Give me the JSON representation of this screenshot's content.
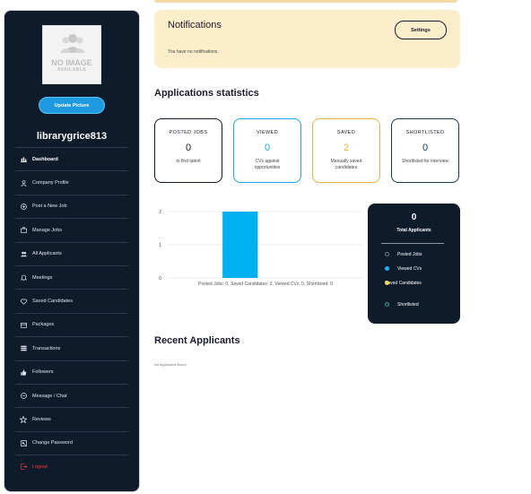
{
  "sidebar": {
    "avatar": {
      "no_image": "NO IMAGE",
      "available": "AVAILABLE"
    },
    "update_button": "Update Picture",
    "username": "librarygrice813",
    "items": [
      {
        "label": "Dashboard",
        "icon": "dashboard-icon"
      },
      {
        "label": "Company Profile",
        "icon": "user-icon"
      },
      {
        "label": "Post a New Job",
        "icon": "plus-circle-icon"
      },
      {
        "label": "Manage Jobs",
        "icon": "briefcase-icon"
      },
      {
        "label": "All Applicants",
        "icon": "users-icon"
      },
      {
        "label": "Meetings",
        "icon": "bell-icon"
      },
      {
        "label": "Saved Candidates",
        "icon": "heart-icon"
      },
      {
        "label": "Packages",
        "icon": "package-icon"
      },
      {
        "label": "Transactions",
        "icon": "transactions-icon"
      },
      {
        "label": "Followers",
        "icon": "thumbs-up-icon"
      },
      {
        "label": "Message / Chat",
        "icon": "chat-icon"
      },
      {
        "label": "Reviews",
        "icon": "star-icon"
      },
      {
        "label": "Change Password",
        "icon": "key-icon"
      },
      {
        "label": "Logout",
        "icon": "logout-icon"
      }
    ]
  },
  "notifications": {
    "title": "Notifications",
    "settings_button": "Settings",
    "empty": "You have no notifications."
  },
  "stats": {
    "title": "Applications statistics",
    "cards": [
      {
        "label": "POSTED JOBS",
        "value": "0",
        "sub": "to find talent",
        "color": "#0d1b2a"
      },
      {
        "label": "VIEWED",
        "value": "0",
        "sub": "CVs against opportunities",
        "color": "#1da9e1"
      },
      {
        "label": "SAVED",
        "value": "2",
        "sub": "Manually saved candidates",
        "color": "#e8b43a"
      },
      {
        "label": "SHORTLISTED",
        "value": "0",
        "sub": "Shortlisted for interview",
        "color": "#143a4a"
      }
    ]
  },
  "chart_data": {
    "type": "bar",
    "categories": [
      "Posted Jobs",
      "Saved Candidates",
      "Viewed CVs",
      "Shortlisted"
    ],
    "values": [
      0,
      2,
      0,
      0
    ],
    "colors": [
      "#0d1b2a",
      "#00b0f0",
      "#f5c518",
      "#0e3b3b"
    ],
    "xlabel": "Posted Jobs: 0, Saved Candidates: 2, Viewed CVs: 0, Shortlisted: 0",
    "ylim": [
      0,
      2
    ],
    "yticks": [
      "0",
      "1",
      "2"
    ],
    "grid": true
  },
  "legend": {
    "total": "0",
    "total_label": "Total Applicants",
    "items": [
      {
        "label": "Posted Jobs",
        "color": "#0d1b2a"
      },
      {
        "label": "Viewed CVs",
        "color": "#1ab2f0"
      },
      {
        "label": "Saved Candidates",
        "color": "#f5c518"
      },
      {
        "label": "Shortlisted",
        "color": "#0e3b3b"
      }
    ]
  },
  "recent": {
    "title": "Recent Applicants",
    "empty": "No Applicants found."
  },
  "colors": {
    "sidebar_bg": "#0d1b2a",
    "accent": "#1e9be0",
    "notification_bg": "#fdeecb",
    "logout": "#ff3b3b"
  }
}
